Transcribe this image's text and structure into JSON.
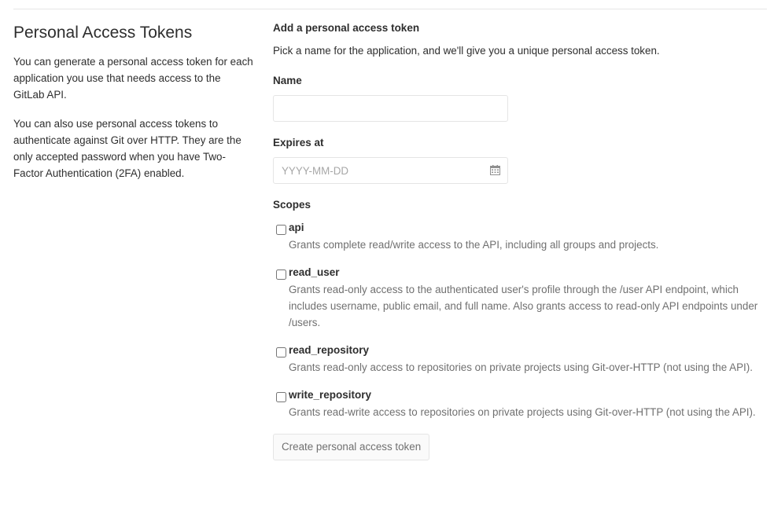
{
  "sidebar": {
    "title": "Personal Access Tokens",
    "paragraph1": "You can generate a personal access token for each application you use that needs access to the GitLab API.",
    "paragraph2": "You can also use personal access tokens to authenticate against Git over HTTP. They are the only accepted password when you have Two-Factor Authentication (2FA) enabled."
  },
  "form": {
    "title": "Add a personal access token",
    "description": "Pick a name for the application, and we'll give you a unique personal access token.",
    "name_label": "Name",
    "name_value": "",
    "expires_label": "Expires at",
    "expires_placeholder": "YYYY-MM-DD",
    "calendar_icon": "calendar-icon",
    "scopes_label": "Scopes",
    "scopes": [
      {
        "name": "api",
        "checked": false,
        "description": "Grants complete read/write access to the API, including all groups and projects."
      },
      {
        "name": "read_user",
        "checked": false,
        "description": "Grants read-only access to the authenticated user's profile through the /user API endpoint, which includes username, public email, and full name. Also grants access to read-only API endpoints under /users."
      },
      {
        "name": "read_repository",
        "checked": false,
        "description": "Grants read-only access to repositories on private projects using Git-over-HTTP (not using the API)."
      },
      {
        "name": "write_repository",
        "checked": false,
        "description": "Grants read-write access to repositories on private projects using Git-over-HTTP (not using the API)."
      }
    ],
    "submit_label": "Create personal access token"
  },
  "colors": {
    "text": "#2e2e2e",
    "muted": "#707070",
    "border": "#e5e5e5",
    "placeholder": "#a7a7a7"
  }
}
